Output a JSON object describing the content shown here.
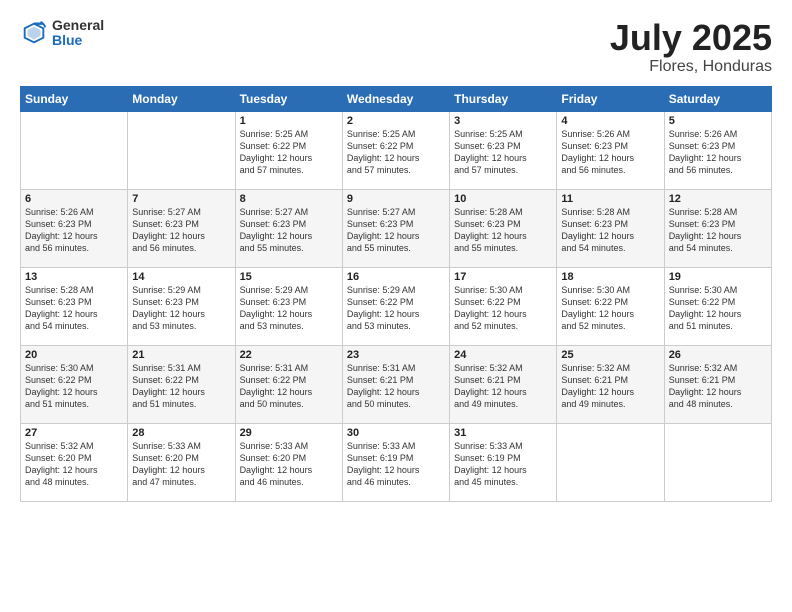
{
  "header": {
    "logo_general": "General",
    "logo_blue": "Blue",
    "main_title": "July 2025",
    "subtitle": "Flores, Honduras"
  },
  "weekdays": [
    "Sunday",
    "Monday",
    "Tuesday",
    "Wednesday",
    "Thursday",
    "Friday",
    "Saturday"
  ],
  "weeks": [
    [
      {
        "day": "",
        "info": ""
      },
      {
        "day": "",
        "info": ""
      },
      {
        "day": "1",
        "info": "Sunrise: 5:25 AM\nSunset: 6:22 PM\nDaylight: 12 hours\nand 57 minutes."
      },
      {
        "day": "2",
        "info": "Sunrise: 5:25 AM\nSunset: 6:22 PM\nDaylight: 12 hours\nand 57 minutes."
      },
      {
        "day": "3",
        "info": "Sunrise: 5:25 AM\nSunset: 6:23 PM\nDaylight: 12 hours\nand 57 minutes."
      },
      {
        "day": "4",
        "info": "Sunrise: 5:26 AM\nSunset: 6:23 PM\nDaylight: 12 hours\nand 56 minutes."
      },
      {
        "day": "5",
        "info": "Sunrise: 5:26 AM\nSunset: 6:23 PM\nDaylight: 12 hours\nand 56 minutes."
      }
    ],
    [
      {
        "day": "6",
        "info": "Sunrise: 5:26 AM\nSunset: 6:23 PM\nDaylight: 12 hours\nand 56 minutes."
      },
      {
        "day": "7",
        "info": "Sunrise: 5:27 AM\nSunset: 6:23 PM\nDaylight: 12 hours\nand 56 minutes."
      },
      {
        "day": "8",
        "info": "Sunrise: 5:27 AM\nSunset: 6:23 PM\nDaylight: 12 hours\nand 55 minutes."
      },
      {
        "day": "9",
        "info": "Sunrise: 5:27 AM\nSunset: 6:23 PM\nDaylight: 12 hours\nand 55 minutes."
      },
      {
        "day": "10",
        "info": "Sunrise: 5:28 AM\nSunset: 6:23 PM\nDaylight: 12 hours\nand 55 minutes."
      },
      {
        "day": "11",
        "info": "Sunrise: 5:28 AM\nSunset: 6:23 PM\nDaylight: 12 hours\nand 54 minutes."
      },
      {
        "day": "12",
        "info": "Sunrise: 5:28 AM\nSunset: 6:23 PM\nDaylight: 12 hours\nand 54 minutes."
      }
    ],
    [
      {
        "day": "13",
        "info": "Sunrise: 5:28 AM\nSunset: 6:23 PM\nDaylight: 12 hours\nand 54 minutes."
      },
      {
        "day": "14",
        "info": "Sunrise: 5:29 AM\nSunset: 6:23 PM\nDaylight: 12 hours\nand 53 minutes."
      },
      {
        "day": "15",
        "info": "Sunrise: 5:29 AM\nSunset: 6:23 PM\nDaylight: 12 hours\nand 53 minutes."
      },
      {
        "day": "16",
        "info": "Sunrise: 5:29 AM\nSunset: 6:22 PM\nDaylight: 12 hours\nand 53 minutes."
      },
      {
        "day": "17",
        "info": "Sunrise: 5:30 AM\nSunset: 6:22 PM\nDaylight: 12 hours\nand 52 minutes."
      },
      {
        "day": "18",
        "info": "Sunrise: 5:30 AM\nSunset: 6:22 PM\nDaylight: 12 hours\nand 52 minutes."
      },
      {
        "day": "19",
        "info": "Sunrise: 5:30 AM\nSunset: 6:22 PM\nDaylight: 12 hours\nand 51 minutes."
      }
    ],
    [
      {
        "day": "20",
        "info": "Sunrise: 5:30 AM\nSunset: 6:22 PM\nDaylight: 12 hours\nand 51 minutes."
      },
      {
        "day": "21",
        "info": "Sunrise: 5:31 AM\nSunset: 6:22 PM\nDaylight: 12 hours\nand 51 minutes."
      },
      {
        "day": "22",
        "info": "Sunrise: 5:31 AM\nSunset: 6:22 PM\nDaylight: 12 hours\nand 50 minutes."
      },
      {
        "day": "23",
        "info": "Sunrise: 5:31 AM\nSunset: 6:21 PM\nDaylight: 12 hours\nand 50 minutes."
      },
      {
        "day": "24",
        "info": "Sunrise: 5:32 AM\nSunset: 6:21 PM\nDaylight: 12 hours\nand 49 minutes."
      },
      {
        "day": "25",
        "info": "Sunrise: 5:32 AM\nSunset: 6:21 PM\nDaylight: 12 hours\nand 49 minutes."
      },
      {
        "day": "26",
        "info": "Sunrise: 5:32 AM\nSunset: 6:21 PM\nDaylight: 12 hours\nand 48 minutes."
      }
    ],
    [
      {
        "day": "27",
        "info": "Sunrise: 5:32 AM\nSunset: 6:20 PM\nDaylight: 12 hours\nand 48 minutes."
      },
      {
        "day": "28",
        "info": "Sunrise: 5:33 AM\nSunset: 6:20 PM\nDaylight: 12 hours\nand 47 minutes."
      },
      {
        "day": "29",
        "info": "Sunrise: 5:33 AM\nSunset: 6:20 PM\nDaylight: 12 hours\nand 46 minutes."
      },
      {
        "day": "30",
        "info": "Sunrise: 5:33 AM\nSunset: 6:19 PM\nDaylight: 12 hours\nand 46 minutes."
      },
      {
        "day": "31",
        "info": "Sunrise: 5:33 AM\nSunset: 6:19 PM\nDaylight: 12 hours\nand 45 minutes."
      },
      {
        "day": "",
        "info": ""
      },
      {
        "day": "",
        "info": ""
      }
    ]
  ]
}
